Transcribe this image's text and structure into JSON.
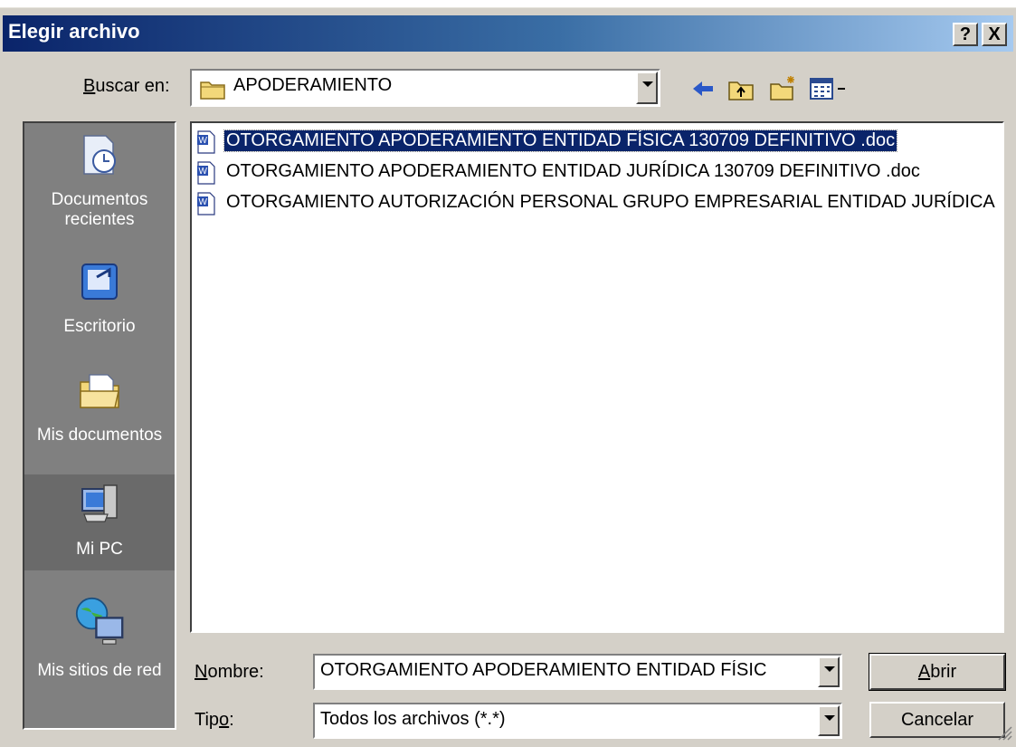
{
  "dialog": {
    "title": "Elegir archivo",
    "help_label": "?",
    "close_label": "X"
  },
  "look_in": {
    "label": "Buscar en:",
    "value": "APODERAMIENTO",
    "icon": "folder-icon"
  },
  "toolbar": {
    "buttons": [
      "back-icon",
      "up-folder-icon",
      "new-folder-icon",
      "view-menu-icon"
    ]
  },
  "places": [
    {
      "label": "Documentos recientes",
      "icon": "recent-documents-icon"
    },
    {
      "label": "Escritorio",
      "icon": "desktop-icon"
    },
    {
      "label": "Mis documentos",
      "icon": "my-documents-icon"
    },
    {
      "label": "Mi PC",
      "icon": "my-computer-icon"
    },
    {
      "label": "Mis sitios de red",
      "icon": "network-places-icon"
    }
  ],
  "files": [
    {
      "name": "OTORGAMIENTO APODERAMIENTO ENTIDAD FÍSICA 130709 DEFINITIVO .doc",
      "selected": true
    },
    {
      "name": "OTORGAMIENTO APODERAMIENTO ENTIDAD JURÍDICA 130709 DEFINITIVO .doc",
      "selected": false
    },
    {
      "name": "OTORGAMIENTO AUTORIZACIÓN PERSONAL GRUPO EMPRESARIAL ENTIDAD JURÍDICA",
      "selected": false
    }
  ],
  "filename": {
    "label": "Nombre:",
    "value": "OTORGAMIENTO APODERAMIENTO ENTIDAD FÍSIC"
  },
  "filetype": {
    "label": "Tipo:",
    "value": "Todos los archivos (*.*)"
  },
  "buttons": {
    "open": "Abrir",
    "cancel": "Cancelar"
  },
  "colors": {
    "title_start": "#0a246a",
    "title_end": "#a6caf0",
    "selection": "#0a246a",
    "face": "#d4d0c8"
  }
}
